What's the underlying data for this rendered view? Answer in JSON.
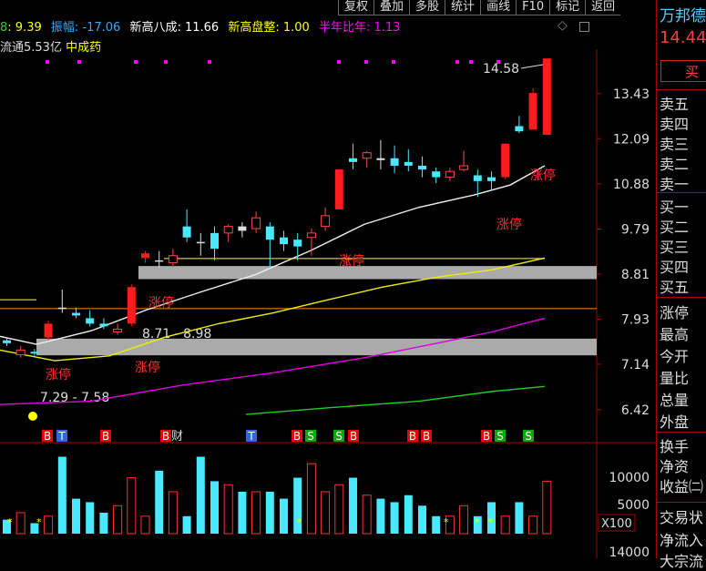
{
  "toolbar": {
    "items": [
      "复权",
      "叠加",
      "多股",
      "统计",
      "画线",
      "F10",
      "标记",
      "返回"
    ]
  },
  "info": {
    "ma_prefix": "8",
    "ma_value": ": 9.39",
    "amplitude": "振幅: -17.06",
    "new_high_80": "新高八成: 11.66",
    "new_high_consolidation": "新高盘整: 1.00",
    "half_year_ratio": "半年比年: 1.13",
    "float_cap": "流通5.53亿",
    "sector": "中成药",
    "icons": [
      "diamond-icon",
      "square-icon"
    ]
  },
  "price_axis": {
    "labels": [
      "13.43",
      "12.09",
      "10.88",
      "9.79",
      "8.81",
      "7.93",
      "7.14",
      "6.42"
    ]
  },
  "volume_axis": {
    "labels": [
      "10000",
      "5000",
      "X100",
      "14000"
    ]
  },
  "annotations": {
    "high_label": "14.58",
    "zone_upper": "8.71 - 8.98",
    "zone_lower": "7.29 - 7.58",
    "limit_up": "涨停",
    "finance": "财"
  },
  "signals": [
    "B",
    "T",
    "B",
    "B",
    "T",
    "B",
    "S",
    "S",
    "B",
    "B",
    "B",
    "B",
    "S",
    "S"
  ],
  "right_panel": {
    "stock_name": "万邦德",
    "price": "14.44",
    "buy_button": "买",
    "sells": [
      "卖五",
      "卖四",
      "卖三",
      "卖二",
      "卖一"
    ],
    "buys": [
      "买一",
      "买二",
      "买三",
      "买四",
      "买五"
    ],
    "stats": [
      "涨停",
      "最高",
      "今开",
      "量比",
      "总量",
      "外盘"
    ],
    "stats2": [
      "换手",
      "净资",
      "收益㈡"
    ],
    "footer": [
      "交易状",
      "净流入",
      "大宗流"
    ]
  },
  "chart_data": {
    "type": "candlestick",
    "price_range": [
      6.1,
      14.9
    ],
    "candles": [
      {
        "o": 7.55,
        "c": 7.5,
        "h": 7.6,
        "l": 7.45,
        "d": "dn"
      },
      {
        "o": 7.3,
        "c": 7.38,
        "h": 7.45,
        "l": 7.25,
        "d": "up"
      },
      {
        "o": 7.35,
        "c": 7.32,
        "h": 7.4,
        "l": 7.28,
        "d": "dn"
      },
      {
        "o": 7.6,
        "c": 7.85,
        "h": 7.9,
        "l": 7.55,
        "d": "lu"
      },
      {
        "o": 8.15,
        "c": 8.13,
        "h": 8.5,
        "l": 8.05,
        "d": "flat"
      },
      {
        "o": 8.05,
        "c": 8.0,
        "h": 8.15,
        "l": 7.95,
        "d": "dn"
      },
      {
        "o": 7.95,
        "c": 7.85,
        "h": 8.1,
        "l": 7.8,
        "d": "dn"
      },
      {
        "o": 7.85,
        "c": 7.8,
        "h": 7.95,
        "l": 7.75,
        "d": "dn"
      },
      {
        "o": 7.7,
        "c": 7.75,
        "h": 7.85,
        "l": 7.65,
        "d": "up"
      },
      {
        "o": 7.85,
        "c": 8.55,
        "h": 8.6,
        "l": 7.8,
        "d": "lu"
      },
      {
        "o": 9.15,
        "c": 9.25,
        "h": 9.3,
        "l": 9.05,
        "d": "lu"
      },
      {
        "o": 9.1,
        "c": 9.1,
        "h": 9.3,
        "l": 8.95,
        "d": "flat"
      },
      {
        "o": 9.2,
        "c": 9.05,
        "h": 9.35,
        "l": 8.95,
        "d": "up"
      },
      {
        "o": 9.6,
        "c": 9.85,
        "h": 10.25,
        "l": 9.5,
        "d": "dn"
      },
      {
        "o": 9.5,
        "c": 9.5,
        "h": 9.7,
        "l": 9.2,
        "d": "flat"
      },
      {
        "o": 9.7,
        "c": 9.35,
        "h": 9.85,
        "l": 9.1,
        "d": "dn"
      },
      {
        "o": 9.7,
        "c": 9.85,
        "h": 9.9,
        "l": 9.5,
        "d": "up"
      },
      {
        "o": 9.85,
        "c": 9.75,
        "h": 9.95,
        "l": 9.6,
        "d": "flat"
      },
      {
        "o": 9.8,
        "c": 10.05,
        "h": 10.2,
        "l": 9.7,
        "d": "up"
      },
      {
        "o": 9.85,
        "c": 9.55,
        "h": 9.95,
        "l": 8.95,
        "d": "dn"
      },
      {
        "o": 9.6,
        "c": 9.45,
        "h": 9.75,
        "l": 9.3,
        "d": "dn"
      },
      {
        "o": 9.55,
        "c": 9.4,
        "h": 9.7,
        "l": 9.1,
        "d": "dn"
      },
      {
        "o": 9.6,
        "c": 9.7,
        "h": 9.8,
        "l": 9.2,
        "d": "up"
      },
      {
        "o": 9.85,
        "c": 10.1,
        "h": 10.3,
        "l": 9.75,
        "d": "up"
      },
      {
        "o": 10.25,
        "c": 11.25,
        "h": 11.25,
        "l": 10.25,
        "d": "lu"
      },
      {
        "o": 11.55,
        "c": 11.45,
        "h": 11.95,
        "l": 11.25,
        "d": "dn"
      },
      {
        "o": 11.55,
        "c": 11.7,
        "h": 11.75,
        "l": 11.3,
        "d": "up"
      },
      {
        "o": 11.55,
        "c": 11.5,
        "h": 12.05,
        "l": 11.25,
        "d": "flat"
      },
      {
        "o": 11.55,
        "c": 11.35,
        "h": 11.9,
        "l": 11.15,
        "d": "dn"
      },
      {
        "o": 11.45,
        "c": 11.35,
        "h": 11.8,
        "l": 11.2,
        "d": "dn"
      },
      {
        "o": 11.35,
        "c": 11.25,
        "h": 11.6,
        "l": 11.05,
        "d": "dn"
      },
      {
        "o": 11.2,
        "c": 11.05,
        "h": 11.3,
        "l": 10.9,
        "d": "dn"
      },
      {
        "o": 11.05,
        "c": 11.2,
        "h": 11.3,
        "l": 10.95,
        "d": "up"
      },
      {
        "o": 11.25,
        "c": 11.35,
        "h": 11.75,
        "l": 11.2,
        "d": "up"
      },
      {
        "o": 11.1,
        "c": 10.95,
        "h": 11.25,
        "l": 10.55,
        "d": "dn"
      },
      {
        "o": 11.05,
        "c": 10.95,
        "h": 11.2,
        "l": 10.7,
        "d": "dn"
      },
      {
        "o": 11.05,
        "c": 11.95,
        "h": 11.95,
        "l": 11.0,
        "d": "lu"
      },
      {
        "o": 12.45,
        "c": 12.3,
        "h": 12.75,
        "l": 12.25,
        "d": "dn"
      },
      {
        "o": 12.35,
        "c": 13.45,
        "h": 13.6,
        "l": 12.35,
        "d": "lu"
      },
      {
        "o": 12.2,
        "c": 14.58,
        "h": 14.58,
        "l": 12.2,
        "d": "lu"
      }
    ],
    "volumes": [
      4,
      6,
      3,
      5,
      22,
      10,
      9,
      6,
      8,
      16,
      5,
      18,
      12,
      5,
      22,
      15,
      14,
      12,
      12,
      12,
      10,
      16,
      20,
      12,
      14,
      16,
      11,
      10,
      9,
      11,
      8,
      5,
      5,
      8,
      5,
      9,
      5,
      9,
      5,
      15
    ]
  }
}
